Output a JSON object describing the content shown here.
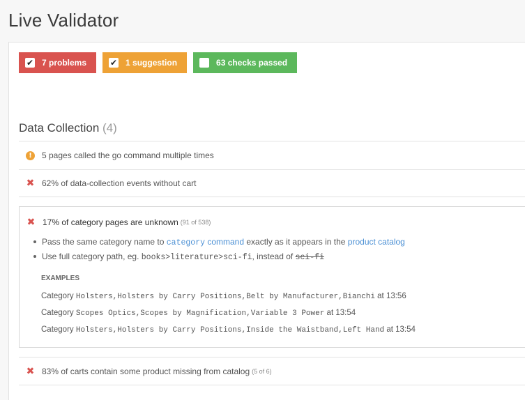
{
  "page": {
    "title": "Live Validator"
  },
  "filters": [
    {
      "label": "7 problems",
      "checked": true,
      "color": "#d9534f"
    },
    {
      "label": "1 suggestion",
      "checked": true,
      "color": "#eea236"
    },
    {
      "label": "63 checks passed",
      "checked": false,
      "color": "#5cb85c"
    }
  ],
  "section": {
    "title": "Data Collection",
    "count": "(4)"
  },
  "issues": [
    {
      "type": "warning",
      "text": "5 pages called the go command multiple times"
    },
    {
      "type": "error",
      "text": "62% of data-collection events without cart"
    },
    {
      "type": "error",
      "text": "17% of category pages are unknown",
      "detail": "(91 of 538)"
    },
    {
      "type": "error",
      "text": "83% of carts contain some product missing from catalog",
      "detail": "(5 of 6)"
    }
  ],
  "expanded": {
    "bullet1": {
      "pre": "Pass the same category name to",
      "code": "category",
      "link1": "command",
      "mid": "exactly as it appears in the",
      "link2": "product catalog"
    },
    "bullet2": {
      "pre": "Use full category path, eg.",
      "code": "books>literature>sci-fi",
      "mid": ", instead of",
      "strike": "sci-fi"
    },
    "examples_label": "EXAMPLES",
    "examples": [
      {
        "prefix": "Category",
        "path": "Holsters,Holsters by Carry Positions,Belt by Manufacturer,Bianchi",
        "time": "at 13:56"
      },
      {
        "prefix": "Category",
        "path": "Scopes Optics,Scopes by Magnification,Variable 3 Power",
        "time": "at 13:54"
      },
      {
        "prefix": "Category",
        "path": "Holsters,Holsters by Carry Positions,Inside the Waistband,Left Hand",
        "time": "at 13:54"
      }
    ]
  },
  "icons": {
    "warning": "exclamation-circle-icon",
    "error": "x-icon",
    "checkbox": "check-icon"
  }
}
